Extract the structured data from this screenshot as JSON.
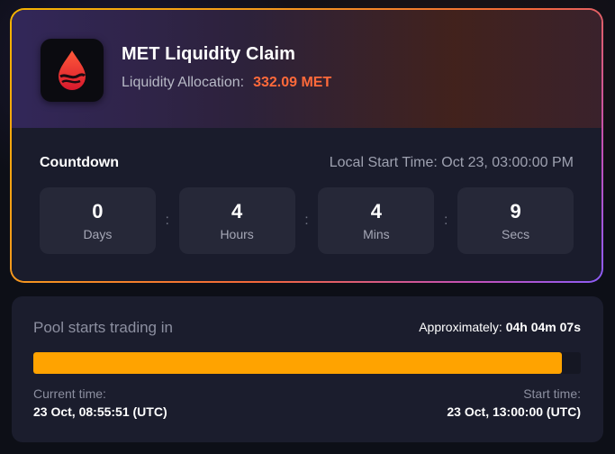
{
  "claim_card": {
    "title": "MET Liquidity Claim",
    "allocation_label": "Liquidity Allocation:",
    "allocation_value": "332.09 MET",
    "logo_icon": "drop-logo-icon",
    "countdown_label": "Countdown",
    "local_start_time": "Local Start Time: Oct 23, 03:00:00 PM",
    "units": [
      {
        "value": "0",
        "label": "Days"
      },
      {
        "value": "4",
        "label": "Hours"
      },
      {
        "value": "4",
        "label": "Mins"
      },
      {
        "value": "9",
        "label": "Secs"
      }
    ],
    "separator": ":"
  },
  "pool_card": {
    "label": "Pool starts trading in",
    "approx_label": "Approximately:",
    "approx_value": "04h 04m 07s",
    "progress_fraction": 0.965,
    "progress_color": "#ffa300",
    "current_time_label": "Current time:",
    "current_time_value": "23 Oct, 08:55:51 (UTC)",
    "start_time_label": "Start time:",
    "start_time_value": "23 Oct, 13:00:00 (UTC)"
  },
  "colors": {
    "accent_orange": "#ff6a3a",
    "progress": "#ffa300"
  }
}
